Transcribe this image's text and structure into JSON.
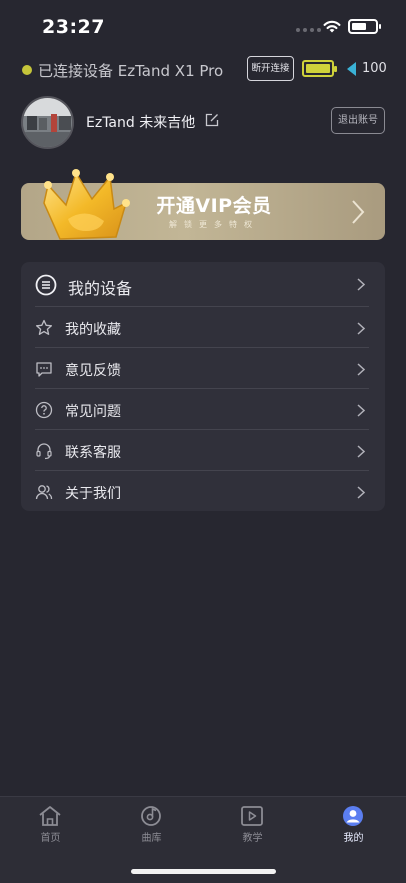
{
  "status_bar": {
    "time": "23:27"
  },
  "device": {
    "status": "已连接设备 EzTand X1 Pro",
    "disconnect_label": "断开连接",
    "volume": "100",
    "status_color": "#c5c53a",
    "battery_color": "#cfd23a"
  },
  "profile": {
    "username": "EzTand 未来吉他",
    "logout_label": "退出账号"
  },
  "vip": {
    "title": "开通VIP会员",
    "subtitle": "解锁更多特权"
  },
  "menu": {
    "items": [
      {
        "label": "我的设备",
        "icon": "device-icon"
      },
      {
        "label": "我的收藏",
        "icon": "star-icon"
      },
      {
        "label": "意见反馈",
        "icon": "feedback-icon"
      },
      {
        "label": "常见问题",
        "icon": "question-icon"
      },
      {
        "label": "联系客服",
        "icon": "headset-icon"
      },
      {
        "label": "关于我们",
        "icon": "users-icon"
      }
    ]
  },
  "tabs": [
    {
      "label": "首页",
      "icon": "home-icon",
      "active": false
    },
    {
      "label": "曲库",
      "icon": "library-icon",
      "active": false
    },
    {
      "label": "教学",
      "icon": "play-icon",
      "active": false
    },
    {
      "label": "我的",
      "icon": "profile-icon",
      "active": true
    }
  ]
}
